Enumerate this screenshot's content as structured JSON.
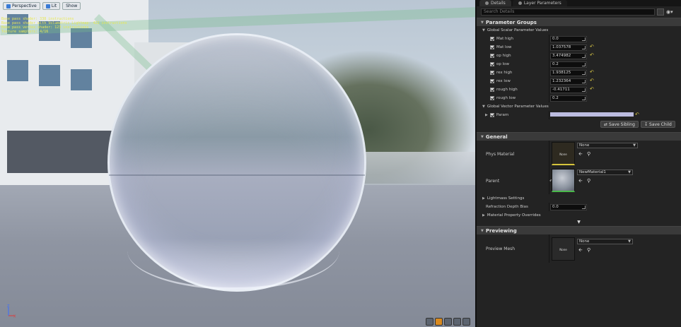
{
  "viewport": {
    "buttons": [
      {
        "label": "Perspective",
        "icon": "perspective-icon"
      },
      {
        "label": "Lit",
        "icon": "lit-icon"
      },
      {
        "label": "Show"
      }
    ],
    "stats": [
      "Base pass shader: 338 instructions",
      "Base pass shader with Volumetric Lightmap: 422 instructions",
      "Base pass vertex shader: 123 instructions",
      "Texture samplers: 4/16"
    ],
    "axis_labels": {
      "z": "Z",
      "x": "X"
    },
    "bottom_icons": [
      "grid-icon",
      "sphere-preview-icon",
      "plane-icon",
      "cube-icon",
      "cylinder-icon"
    ]
  },
  "panel": {
    "tabs": [
      {
        "label": "Details",
        "icon": "details-icon"
      },
      {
        "label": "Layer Parameters",
        "icon": "layer-icon"
      }
    ],
    "search_placeholder": "Search Details",
    "parameter_groups": {
      "title": "Parameter Groups",
      "scalar_group_title": "Global Scalar Parameter Values",
      "scalars": [
        {
          "name": "Mat high",
          "value": "0.0",
          "reset": false
        },
        {
          "name": "Mat low",
          "value": "1.037578",
          "reset": true
        },
        {
          "name": "op high",
          "value": "3.474982",
          "reset": true
        },
        {
          "name": "op low",
          "value": "0.2",
          "reset": false
        },
        {
          "name": "rex high",
          "value": "1.938125",
          "reset": true
        },
        {
          "name": "rex low",
          "value": "1.232364",
          "reset": true
        },
        {
          "name": "rough high",
          "value": "-0.41711",
          "reset": true
        },
        {
          "name": "rough low",
          "value": "0.2",
          "reset": false
        }
      ],
      "vector_group_title": "Global Vector Parameter Values",
      "vector_param": {
        "name": "Param",
        "color": "#bcbce0"
      },
      "save_sibling": "Save Sibling",
      "save_child": "Save Child"
    },
    "general": {
      "title": "General",
      "phys_material": {
        "label": "Phys Material",
        "thumb": "None",
        "value": "None"
      },
      "parent": {
        "label": "Parent",
        "value": "NewMaterial1"
      },
      "lightmass": "Lightmass Settings",
      "refraction": {
        "label": "Refraction Depth Bias",
        "value": "0.0"
      },
      "overrides": "Material Property Overrides"
    },
    "previewing": {
      "title": "Previewing",
      "preview_mesh": {
        "label": "Preview Mesh",
        "thumb": "None",
        "value": "None"
      }
    }
  }
}
